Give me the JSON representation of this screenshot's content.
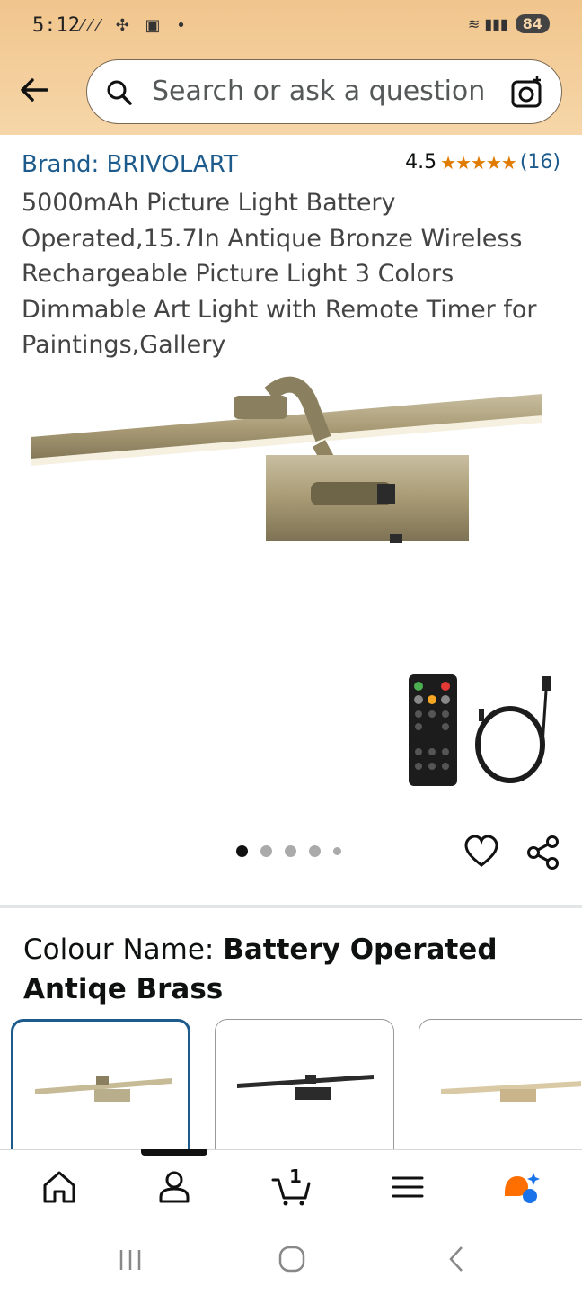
{
  "status_bar": {
    "time": "5:12",
    "battery": "84"
  },
  "search": {
    "placeholder": "Search or ask a question"
  },
  "product": {
    "brand": "Brand: BRIVOLART",
    "rating_value": "4.5",
    "rating_stars": "★★★★★",
    "rating_count": "(16)",
    "title": "5000mAh Picture Light Battery Operated,15.7In Antique Bronze Wireless Rechargeable Picture Light 3 Colors Dimmable Art Light with Remote Timer for Paintings,Gallery",
    "image_count": 5,
    "active_image": 1
  },
  "variant": {
    "label": "Colour Name:",
    "value": "Battery Operated Antiqe Brass",
    "swatches": [
      {
        "name": "Antique Brass",
        "color": "#b9ae8c",
        "selected": true
      },
      {
        "name": "Black",
        "color": "#2b2b2b",
        "selected": false
      },
      {
        "name": "Gold",
        "color": "#c9b48c",
        "selected": false
      }
    ]
  },
  "bottom_nav": {
    "cart_count": "1",
    "items": [
      "home-icon",
      "account-icon",
      "cart-icon",
      "menu-icon",
      "rufus-ai-icon"
    ]
  },
  "colors": {
    "header": "#f4cf9c",
    "link": "#1d5b8d",
    "star": "#e07b00"
  }
}
